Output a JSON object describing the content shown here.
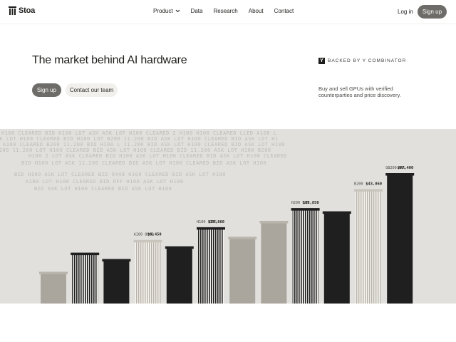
{
  "nav": {
    "logo_text": "Stoa",
    "links": [
      {
        "label": "Product",
        "has_dropdown": true
      },
      {
        "label": "Data"
      },
      {
        "label": "Research"
      },
      {
        "label": "About"
      },
      {
        "label": "Contact"
      }
    ],
    "login_label": "Log in",
    "signup_label": "Sign up"
  },
  "hero": {
    "title": "The market behind AI hardware",
    "primary_cta": "Sign up",
    "secondary_cta": "Contact our team",
    "badge_logo": "Y",
    "badge_text": "BACKED BY Y COMBINATOR",
    "tagline": "Buy and sell GPUs with verified counterparties and price discovery."
  },
  "background_ticker": [
    "H100 CLEARED  BID   H100 LOT ASK      ASK  LOT H100 CLEARED  2 H100     H100 CLEARED  LLED   A100 L",
    "ASK  LOT H100 CLEARED  BID H100 LOT    B200 11.200  BID ASK  LOT H100  CLEARED  BID ASK  LOT H1",
    "A100 CLEARED  B200 11.200 BID  H100 L  11.200  BID  ASK  LOT H100 CLEARED  BID  ASK  LOT H100",
    "B200 11.200  LOT  H100 CLEARED  BID   ASK  LOT H100 CLEARED  BID  11.200  ASK  LOT  H100  B200",
    "  H100 2   LOT  ASK   CLEARED  BID   H100  ASK  LOT  H100  CLEARED  BID ASK  LOT  H100 CLEARED",
    "  BID  H100  LOT  ASK  11.200  CLEARED  BID  ASK  LOT  H100  CLEARED  BID  ASK  LOT  H100",
    "   BID   H100 ASK  LOT   CLEARED  BID  0448 H100  CLEARED  BID  ASK  LOT H100",
    "  A100  LOT  H100 CLEARED  BID OFF  H100  ASK  LOT  H100",
    "  BID  ASK  LOT  H100  CLEARED  BID  ASK  LOT  H100"
  ],
  "chart_data": {
    "type": "bar",
    "title": "",
    "xlabel": "",
    "ylabel": "",
    "categories": [
      "",
      "",
      "",
      "A100 80GB",
      "",
      "H100 SXM5",
      "",
      "",
      "H200 SXM",
      "",
      "B200",
      "GB200 NVL"
    ],
    "values": [
      10,
      16,
      14,
      20,
      18,
      24,
      21,
      26,
      30,
      29,
      36,
      41
    ],
    "styles": [
      "solid-taupe",
      "striped-dark",
      "solid-dark",
      "striped-light",
      "solid-dark",
      "striped-dark",
      "solid-taupe",
      "solid-taupe",
      "striped-dark",
      "solid-dark",
      "striped-light",
      "solid-dark"
    ],
    "price_labels": [
      "",
      "",
      "",
      "$9,450",
      "",
      "$25,860",
      "",
      "",
      "$33,850",
      "",
      "$43,860",
      "$67,400"
    ],
    "colors": {
      "dark": "#1f1f1f",
      "taupe": "#aaa69d",
      "light_stripe": "#c9c5bd",
      "band_bg": "#e1e0dc"
    }
  }
}
